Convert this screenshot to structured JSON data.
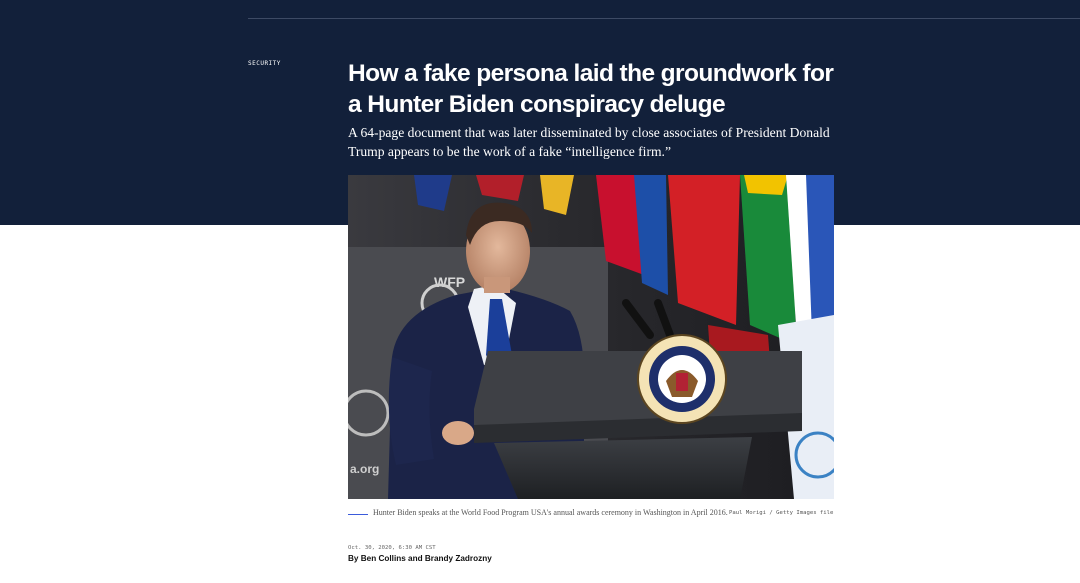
{
  "article": {
    "section": "SECURITY",
    "headline": "How a fake persona laid the groundwork for a Hunter Biden conspiracy deluge",
    "dek": "A 64-page document that was later disseminated by close associates of President Donald Trump appears to be the work of a fake “intelligence firm.”",
    "photo": {
      "caption": "Hunter Biden speaks at the World Food Program USA's annual awards ceremony in Washington in April 2016.",
      "credit": "Paul Morigi / Getty Images file",
      "seal_text": "VICE PRESIDENT OF THE UNITED STATES",
      "backdrop_text": "WFP",
      "backdrop_url": "a.org"
    },
    "date": "Oct. 30, 2020, 6:30 AM CST",
    "byline": "By Ben Collins and Brandy Zadrozny"
  },
  "colors": {
    "hero_background": "#12203a",
    "caption_rule": "#3b5bdb"
  }
}
